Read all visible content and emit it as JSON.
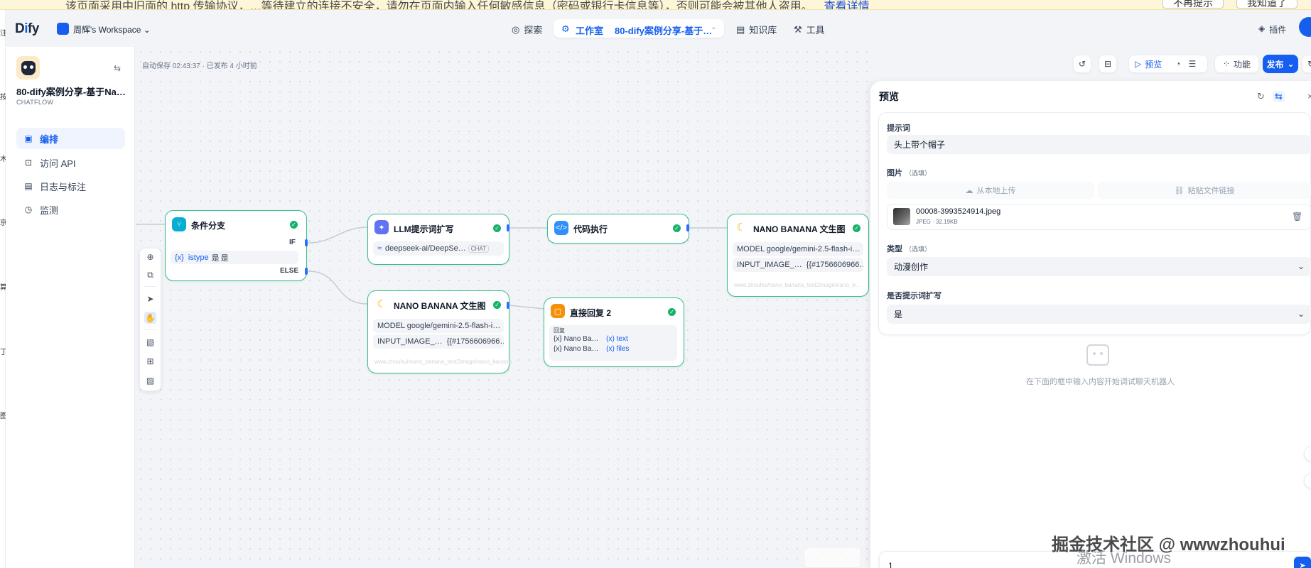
{
  "banner": {
    "text": "该页面采用中旧面的 http 传输协议，…等待建立的连接不安全，请勿在页面内输入任何敏感信息（密码或银行卡信息等），否则可能会被其他人盗用。",
    "link": "查看详情",
    "btn1": "不再提示",
    "btn2": "我知道了"
  },
  "strip_chars": [
    "注",
    "按",
    "木",
    "京",
    "算",
    "丁",
    "图"
  ],
  "header": {
    "logo_pre": "D",
    "logo_i": "i",
    "logo_post": "fy",
    "workspace": "周辉's Workspace",
    "nav_explore": "探索",
    "nav_studio": "工作室",
    "nav_app": "80-dify案例分享-基于…",
    "nav_knowledge": "知识库",
    "nav_tools": "工具",
    "plugins": "插件"
  },
  "sidebar": {
    "app_title": "80-dify案例分享-基于Na…",
    "app_type": "CHATFLOW",
    "items": [
      {
        "label": "编排",
        "icon": "layout-icon"
      },
      {
        "label": "访问 API",
        "icon": "terminal-icon"
      },
      {
        "label": "日志与标注",
        "icon": "log-icon"
      },
      {
        "label": "监测",
        "icon": "monitor-icon"
      }
    ]
  },
  "canvas": {
    "autosave": "自动保存 02:43:37 · 已发布 4 小时前"
  },
  "nodes": {
    "ifelse": {
      "title": "条件分支",
      "if": "IF",
      "else": "ELSE",
      "cond_var": "{x}",
      "cond_name": "istype",
      "cond_op": "是",
      "cond_val": "是"
    },
    "llm": {
      "title": "LLM提示词扩写",
      "model": "deepseek-ai/DeepSe…",
      "tag": "CHAT"
    },
    "code": {
      "title": "代码执行"
    },
    "nano1": {
      "title": "NANO BANANA 文生图",
      "row1": "MODEL google/gemini-2.5-flash-i…",
      "row2_key": "INPUT_IMAGE_…",
      "row2_val": "{{#1756606966…",
      "footer": "www.zhouhui/nano_banana_text2image/nano_b…"
    },
    "nano2": {
      "title": "NANO BANANA 文生图",
      "row1": "MODEL google/gemini-2.5-flash-i…",
      "row2_key": "INPUT_IMAGE_…",
      "row2_val": "{{#1756606966…",
      "footer": "www.zhouhui/nano_banana_text2image/nano_banana"
    },
    "answer": {
      "title": "直接回复 2",
      "label": "回复",
      "r1_name": "Nano Ba…",
      "r1_var": "text",
      "r2_name": "Nano Ba…",
      "r2_var": "files",
      "var_prefix": "{x}"
    }
  },
  "actions": {
    "preview": "预览",
    "features": "功能",
    "publish": "发布"
  },
  "panel": {
    "title": "预览",
    "prompt_label": "提示词",
    "prompt_value": "头上带个帽子",
    "image_label": "图片",
    "optional": "（选填）",
    "upload_local": "从本地上传",
    "paste_link": "粘贴文件链接",
    "file_name": "00008-3993524914.jpeg",
    "file_meta": "JPEG · 32.19KB",
    "type_label": "类型",
    "type_value": "动漫创作",
    "expand_label": "是否提示词扩写",
    "expand_value": "是",
    "empty_text": "在下面的框中输入内容开始调试聊天机器人",
    "chat_value": "1"
  },
  "watermark": "掘金技术社区 @ wwwzhouhui",
  "win_activate": "激活 Windows",
  "colors": {
    "accent": "#155eef",
    "node_border": "#36bf8f",
    "success": "#17b26a"
  }
}
